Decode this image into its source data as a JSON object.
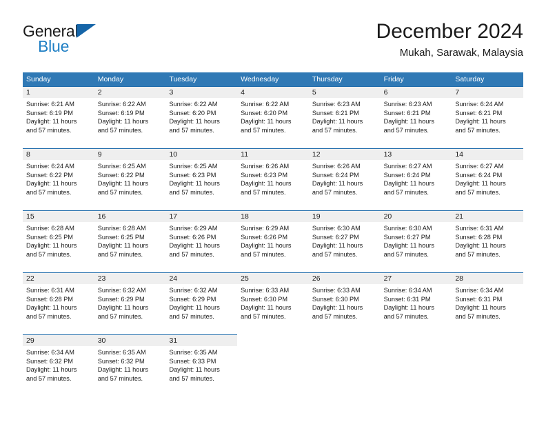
{
  "brand": {
    "name_part1": "General",
    "name_part2": "Blue",
    "triangle_color": "#1565a8",
    "blue_color": "#1f7fc4"
  },
  "header": {
    "title": "December 2024",
    "location": "Mukah, Sarawak, Malaysia"
  },
  "theme": {
    "header_band": "#3079b5",
    "day_band": "#efefef",
    "day_band_border": "#1f6cab",
    "text": "#1a1a1a"
  },
  "weekdays": [
    "Sunday",
    "Monday",
    "Tuesday",
    "Wednesday",
    "Thursday",
    "Friday",
    "Saturday"
  ],
  "weeks": [
    [
      {
        "day": "1",
        "sunrise": "Sunrise: 6:21 AM",
        "sunset": "Sunset: 6:19 PM",
        "daylight1": "Daylight: 11 hours",
        "daylight2": "and 57 minutes."
      },
      {
        "day": "2",
        "sunrise": "Sunrise: 6:22 AM",
        "sunset": "Sunset: 6:19 PM",
        "daylight1": "Daylight: 11 hours",
        "daylight2": "and 57 minutes."
      },
      {
        "day": "3",
        "sunrise": "Sunrise: 6:22 AM",
        "sunset": "Sunset: 6:20 PM",
        "daylight1": "Daylight: 11 hours",
        "daylight2": "and 57 minutes."
      },
      {
        "day": "4",
        "sunrise": "Sunrise: 6:22 AM",
        "sunset": "Sunset: 6:20 PM",
        "daylight1": "Daylight: 11 hours",
        "daylight2": "and 57 minutes."
      },
      {
        "day": "5",
        "sunrise": "Sunrise: 6:23 AM",
        "sunset": "Sunset: 6:21 PM",
        "daylight1": "Daylight: 11 hours",
        "daylight2": "and 57 minutes."
      },
      {
        "day": "6",
        "sunrise": "Sunrise: 6:23 AM",
        "sunset": "Sunset: 6:21 PM",
        "daylight1": "Daylight: 11 hours",
        "daylight2": "and 57 minutes."
      },
      {
        "day": "7",
        "sunrise": "Sunrise: 6:24 AM",
        "sunset": "Sunset: 6:21 PM",
        "daylight1": "Daylight: 11 hours",
        "daylight2": "and 57 minutes."
      }
    ],
    [
      {
        "day": "8",
        "sunrise": "Sunrise: 6:24 AM",
        "sunset": "Sunset: 6:22 PM",
        "daylight1": "Daylight: 11 hours",
        "daylight2": "and 57 minutes."
      },
      {
        "day": "9",
        "sunrise": "Sunrise: 6:25 AM",
        "sunset": "Sunset: 6:22 PM",
        "daylight1": "Daylight: 11 hours",
        "daylight2": "and 57 minutes."
      },
      {
        "day": "10",
        "sunrise": "Sunrise: 6:25 AM",
        "sunset": "Sunset: 6:23 PM",
        "daylight1": "Daylight: 11 hours",
        "daylight2": "and 57 minutes."
      },
      {
        "day": "11",
        "sunrise": "Sunrise: 6:26 AM",
        "sunset": "Sunset: 6:23 PM",
        "daylight1": "Daylight: 11 hours",
        "daylight2": "and 57 minutes."
      },
      {
        "day": "12",
        "sunrise": "Sunrise: 6:26 AM",
        "sunset": "Sunset: 6:24 PM",
        "daylight1": "Daylight: 11 hours",
        "daylight2": "and 57 minutes."
      },
      {
        "day": "13",
        "sunrise": "Sunrise: 6:27 AM",
        "sunset": "Sunset: 6:24 PM",
        "daylight1": "Daylight: 11 hours",
        "daylight2": "and 57 minutes."
      },
      {
        "day": "14",
        "sunrise": "Sunrise: 6:27 AM",
        "sunset": "Sunset: 6:24 PM",
        "daylight1": "Daylight: 11 hours",
        "daylight2": "and 57 minutes."
      }
    ],
    [
      {
        "day": "15",
        "sunrise": "Sunrise: 6:28 AM",
        "sunset": "Sunset: 6:25 PM",
        "daylight1": "Daylight: 11 hours",
        "daylight2": "and 57 minutes."
      },
      {
        "day": "16",
        "sunrise": "Sunrise: 6:28 AM",
        "sunset": "Sunset: 6:25 PM",
        "daylight1": "Daylight: 11 hours",
        "daylight2": "and 57 minutes."
      },
      {
        "day": "17",
        "sunrise": "Sunrise: 6:29 AM",
        "sunset": "Sunset: 6:26 PM",
        "daylight1": "Daylight: 11 hours",
        "daylight2": "and 57 minutes."
      },
      {
        "day": "18",
        "sunrise": "Sunrise: 6:29 AM",
        "sunset": "Sunset: 6:26 PM",
        "daylight1": "Daylight: 11 hours",
        "daylight2": "and 57 minutes."
      },
      {
        "day": "19",
        "sunrise": "Sunrise: 6:30 AM",
        "sunset": "Sunset: 6:27 PM",
        "daylight1": "Daylight: 11 hours",
        "daylight2": "and 57 minutes."
      },
      {
        "day": "20",
        "sunrise": "Sunrise: 6:30 AM",
        "sunset": "Sunset: 6:27 PM",
        "daylight1": "Daylight: 11 hours",
        "daylight2": "and 57 minutes."
      },
      {
        "day": "21",
        "sunrise": "Sunrise: 6:31 AM",
        "sunset": "Sunset: 6:28 PM",
        "daylight1": "Daylight: 11 hours",
        "daylight2": "and 57 minutes."
      }
    ],
    [
      {
        "day": "22",
        "sunrise": "Sunrise: 6:31 AM",
        "sunset": "Sunset: 6:28 PM",
        "daylight1": "Daylight: 11 hours",
        "daylight2": "and 57 minutes."
      },
      {
        "day": "23",
        "sunrise": "Sunrise: 6:32 AM",
        "sunset": "Sunset: 6:29 PM",
        "daylight1": "Daylight: 11 hours",
        "daylight2": "and 57 minutes."
      },
      {
        "day": "24",
        "sunrise": "Sunrise: 6:32 AM",
        "sunset": "Sunset: 6:29 PM",
        "daylight1": "Daylight: 11 hours",
        "daylight2": "and 57 minutes."
      },
      {
        "day": "25",
        "sunrise": "Sunrise: 6:33 AM",
        "sunset": "Sunset: 6:30 PM",
        "daylight1": "Daylight: 11 hours",
        "daylight2": "and 57 minutes."
      },
      {
        "day": "26",
        "sunrise": "Sunrise: 6:33 AM",
        "sunset": "Sunset: 6:30 PM",
        "daylight1": "Daylight: 11 hours",
        "daylight2": "and 57 minutes."
      },
      {
        "day": "27",
        "sunrise": "Sunrise: 6:34 AM",
        "sunset": "Sunset: 6:31 PM",
        "daylight1": "Daylight: 11 hours",
        "daylight2": "and 57 minutes."
      },
      {
        "day": "28",
        "sunrise": "Sunrise: 6:34 AM",
        "sunset": "Sunset: 6:31 PM",
        "daylight1": "Daylight: 11 hours",
        "daylight2": "and 57 minutes."
      }
    ],
    [
      {
        "day": "29",
        "sunrise": "Sunrise: 6:34 AM",
        "sunset": "Sunset: 6:32 PM",
        "daylight1": "Daylight: 11 hours",
        "daylight2": "and 57 minutes."
      },
      {
        "day": "30",
        "sunrise": "Sunrise: 6:35 AM",
        "sunset": "Sunset: 6:32 PM",
        "daylight1": "Daylight: 11 hours",
        "daylight2": "and 57 minutes."
      },
      {
        "day": "31",
        "sunrise": "Sunrise: 6:35 AM",
        "sunset": "Sunset: 6:33 PM",
        "daylight1": "Daylight: 11 hours",
        "daylight2": "and 57 minutes."
      },
      {
        "day": "",
        "sunrise": "",
        "sunset": "",
        "daylight1": "",
        "daylight2": ""
      },
      {
        "day": "",
        "sunrise": "",
        "sunset": "",
        "daylight1": "",
        "daylight2": ""
      },
      {
        "day": "",
        "sunrise": "",
        "sunset": "",
        "daylight1": "",
        "daylight2": ""
      },
      {
        "day": "",
        "sunrise": "",
        "sunset": "",
        "daylight1": "",
        "daylight2": ""
      }
    ]
  ]
}
